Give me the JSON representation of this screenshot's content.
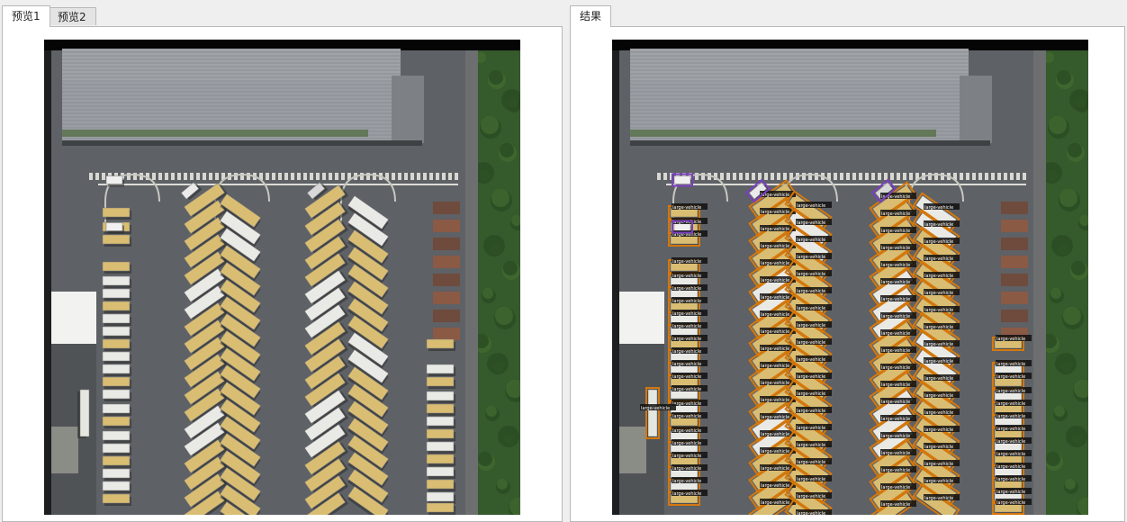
{
  "left_pane": {
    "tabs": [
      {
        "label": "预览1",
        "active": true
      },
      {
        "label": "预览2",
        "active": false
      }
    ]
  },
  "right_pane": {
    "tabs": [
      {
        "label": "结果",
        "active": true
      }
    ]
  },
  "detection": {
    "class_label": "large-vehicle",
    "box_color": "#d4780d",
    "small_box_color": "#7a3fc0"
  },
  "colors": {
    "asphalt": "#5e6165",
    "roof": "#9a9ea3",
    "vegetation": "#355a2b",
    "bus_yellow": "#d9bd72",
    "bus_white": "#e9e9e6"
  }
}
